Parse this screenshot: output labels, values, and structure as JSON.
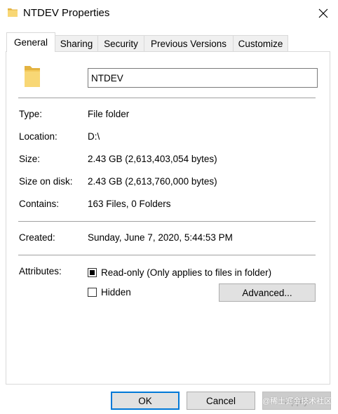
{
  "window": {
    "title": "NTDEV Properties",
    "title_icon": "folder-icon",
    "close_icon": "close-icon"
  },
  "tabs": [
    {
      "label": "General",
      "active": true
    },
    {
      "label": "Sharing",
      "active": false
    },
    {
      "label": "Security",
      "active": false
    },
    {
      "label": "Previous Versions",
      "active": false
    },
    {
      "label": "Customize",
      "active": false
    }
  ],
  "general": {
    "folder_icon": "folder-icon",
    "name_value": "NTDEV",
    "rows": [
      {
        "label": "Type:",
        "value": "File folder"
      },
      {
        "label": "Location:",
        "value": "D:\\"
      },
      {
        "label": "Size:",
        "value": "2.43 GB (2,613,403,054 bytes)"
      },
      {
        "label": "Size on disk:",
        "value": "2.43 GB (2,613,760,000 bytes)"
      },
      {
        "label": "Contains:",
        "value": "163 Files, 0 Folders"
      }
    ],
    "created": {
      "label": "Created:",
      "value": "Sunday, June 7, 2020, 5:44:53 PM"
    },
    "attributes": {
      "label": "Attributes:",
      "readonly": {
        "label": "Read-only (Only applies to files in folder)",
        "state": "indeterminate"
      },
      "hidden": {
        "label": "Hidden",
        "state": "unchecked"
      },
      "advanced_label": "Advanced..."
    }
  },
  "footer": {
    "ok_label": "OK",
    "cancel_label": "Cancel",
    "apply_label": "Apply"
  },
  "watermark": "@稀土掘金技术社区",
  "colors": {
    "folder_yellow": "#f8d775",
    "folder_dark": "#e3b341",
    "accent_blue": "#0078d7"
  }
}
